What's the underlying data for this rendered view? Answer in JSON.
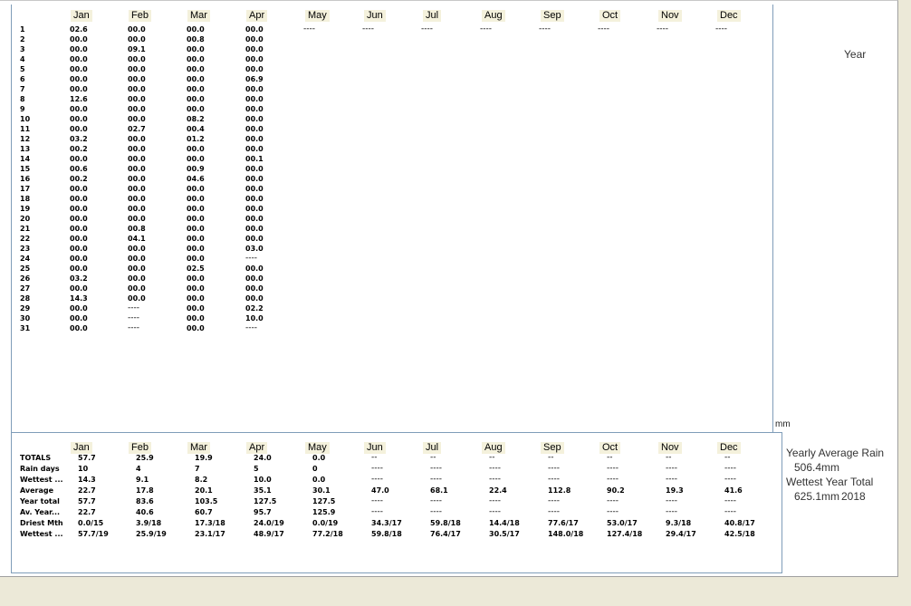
{
  "months": [
    "Jan",
    "Feb",
    "Mar",
    "Apr",
    "May",
    "Jun",
    "Jul",
    "Aug",
    "Sep",
    "Oct",
    "Nov",
    "Dec"
  ],
  "daily": {
    "days": [
      "1",
      "2",
      "3",
      "4",
      "5",
      "6",
      "7",
      "8",
      "9",
      "10",
      "11",
      "12",
      "13",
      "14",
      "15",
      "16",
      "17",
      "18",
      "19",
      "20",
      "21",
      "22",
      "23",
      "24",
      "25",
      "26",
      "27",
      "28",
      "29",
      "30",
      "31"
    ],
    "values": [
      [
        "02.6",
        "00.0",
        "00.0",
        "00.0",
        "00.0",
        "00.0",
        "00.0",
        "12.6",
        "00.0",
        "00.0",
        "00.0",
        "03.2",
        "00.2",
        "00.0",
        "00.6",
        "00.2",
        "00.0",
        "00.0",
        "00.0",
        "00.0",
        "00.0",
        "00.0",
        "00.0",
        "00.0",
        "00.0",
        "03.2",
        "00.0",
        "14.3",
        "00.0",
        "00.0",
        "00.0"
      ],
      [
        "00.0",
        "00.0",
        "09.1",
        "00.0",
        "00.0",
        "00.0",
        "00.0",
        "00.0",
        "00.0",
        "00.0",
        "02.7",
        "00.0",
        "00.0",
        "00.0",
        "00.0",
        "00.0",
        "00.0",
        "00.0",
        "00.0",
        "00.0",
        "00.8",
        "04.1",
        "00.0",
        "00.0",
        "00.0",
        "00.0",
        "00.0",
        "00.0",
        "----",
        "----",
        "----"
      ],
      [
        "00.0",
        "00.8",
        "00.0",
        "00.0",
        "00.0",
        "00.0",
        "00.0",
        "00.0",
        "00.0",
        "08.2",
        "00.4",
        "01.2",
        "00.0",
        "00.0",
        "00.9",
        "04.6",
        "00.0",
        "00.0",
        "00.0",
        "00.0",
        "00.0",
        "00.0",
        "00.0",
        "00.0",
        "02.5",
        "00.0",
        "00.0",
        "00.0",
        "00.0",
        "00.0",
        "00.0"
      ],
      [
        "00.0",
        "00.0",
        "00.0",
        "00.0",
        "00.0",
        "06.9",
        "00.0",
        "00.0",
        "00.0",
        "00.0",
        "00.0",
        "00.0",
        "00.0",
        "00.1",
        "00.0",
        "00.0",
        "00.0",
        "00.0",
        "00.0",
        "00.0",
        "00.0",
        "00.0",
        "03.0",
        "----",
        "00.0",
        "00.0",
        "00.0",
        "00.0",
        "02.2",
        "10.0",
        "----"
      ]
    ],
    "empty_marker": "----"
  },
  "summary": {
    "rows": [
      {
        "label": "TOTALS",
        "values": [
          "57.7",
          "25.9",
          "19.9",
          "24.0",
          "0.0",
          "--",
          "--",
          "--",
          "--",
          "--",
          "--",
          "--"
        ]
      },
      {
        "label": "Rain days",
        "values": [
          "10",
          "4",
          "7",
          "5",
          "0",
          "----",
          "----",
          "----",
          "----",
          "----",
          "----",
          "----"
        ]
      },
      {
        "label": "Wettest ...",
        "values": [
          "14.3",
          "9.1",
          "8.2",
          "10.0",
          "0.0",
          "----",
          "----",
          "----",
          "----",
          "----",
          "----",
          "----"
        ]
      },
      {
        "label": "Average",
        "values": [
          "22.7",
          "17.8",
          "20.1",
          "35.1",
          "30.1",
          "47.0",
          "68.1",
          "22.4",
          "112.8",
          "90.2",
          "19.3",
          "41.6"
        ]
      },
      {
        "label": "Year total",
        "values": [
          "57.7",
          "83.6",
          "103.5",
          "127.5",
          "127.5",
          "----",
          "----",
          "----",
          "----",
          "----",
          "----",
          "----"
        ]
      },
      {
        "label": "Av. Year...",
        "values": [
          "22.7",
          "40.6",
          "60.7",
          "95.7",
          "125.9",
          "----",
          "----",
          "----",
          "----",
          "----",
          "----",
          "----"
        ]
      },
      {
        "label": "Driest Mth",
        "values": [
          "0.0/15",
          "3.9/18",
          "17.3/18",
          "24.0/19",
          "0.0/19",
          "34.3/17",
          "59.8/18",
          "14.4/18",
          "77.6/17",
          "53.0/17",
          "9.3/18",
          "40.8/17"
        ]
      },
      {
        "label": "Wettest ...",
        "values": [
          "57.7/19",
          "25.9/19",
          "23.1/17",
          "48.9/17",
          "77.2/18",
          "59.8/18",
          "76.4/17",
          "30.5/17",
          "148.0/18",
          "127.4/18",
          "29.4/17",
          "42.5/18"
        ]
      }
    ]
  },
  "side": {
    "year_label": "Year",
    "unit": "mm",
    "yearly_avg_label": "Yearly Average Rain",
    "yearly_avg_value": "506.4mm",
    "wettest_year_label": "Wettest Year Total",
    "wettest_year_value": "625.1mm",
    "wettest_year": "2018"
  }
}
